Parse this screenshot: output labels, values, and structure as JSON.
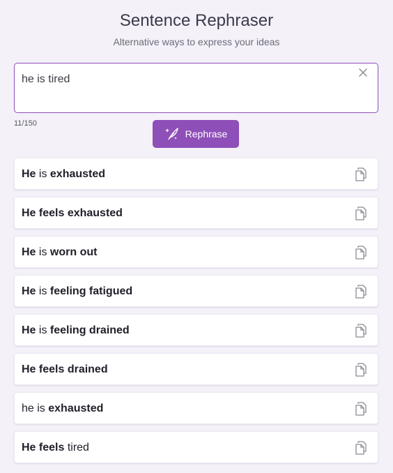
{
  "header": {
    "title": "Sentence Rephraser",
    "subtitle": "Alternative ways to express your ideas"
  },
  "input": {
    "value": "he is tired",
    "counter": "11/150"
  },
  "actions": {
    "rephrase_label": "Rephrase"
  },
  "colors": {
    "accent": "#8e4fb8",
    "background": "#f4f1f9"
  },
  "results": [
    {
      "parts": [
        {
          "text": "He",
          "bold": true
        },
        {
          "text": " is ",
          "bold": false
        },
        {
          "text": "exhausted",
          "bold": true
        }
      ]
    },
    {
      "parts": [
        {
          "text": "He feels exhausted",
          "bold": true
        }
      ]
    },
    {
      "parts": [
        {
          "text": "He",
          "bold": true
        },
        {
          "text": " is ",
          "bold": false
        },
        {
          "text": "worn out",
          "bold": true
        }
      ]
    },
    {
      "parts": [
        {
          "text": "He",
          "bold": true
        },
        {
          "text": " is ",
          "bold": false
        },
        {
          "text": "feeling fatigued",
          "bold": true
        }
      ]
    },
    {
      "parts": [
        {
          "text": "He",
          "bold": true
        },
        {
          "text": " is ",
          "bold": false
        },
        {
          "text": "feeling drained",
          "bold": true
        }
      ]
    },
    {
      "parts": [
        {
          "text": "He feels drained",
          "bold": true
        }
      ]
    },
    {
      "parts": [
        {
          "text": "he is ",
          "bold": false
        },
        {
          "text": "exhausted",
          "bold": true
        }
      ]
    },
    {
      "parts": [
        {
          "text": "He feels",
          "bold": true
        },
        {
          "text": " tired",
          "bold": false
        }
      ]
    }
  ],
  "icons": {
    "clear": "close-icon",
    "rephrase": "sparkle-feather-icon",
    "copy": "copy-icon"
  }
}
